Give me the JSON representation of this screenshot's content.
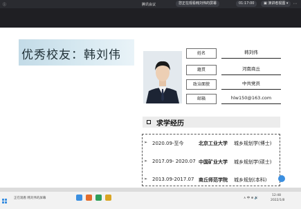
{
  "top_bar": {
    "left_label": "ⓘ",
    "meeting_app": "腾讯会议",
    "share_notice": "您正在观看韩刘伟的屏幕",
    "timer": "01:17:00",
    "view_mode": "▣ 演讲者视图 ▾"
  },
  "slide": {
    "title": "优秀校友：韩刘伟",
    "info": [
      {
        "label": "姓名",
        "value": "韩刘伟"
      },
      {
        "label": "籍贯",
        "value": "河南商丘"
      },
      {
        "label": "政治面貌",
        "value": "中共党员"
      },
      {
        "label": "邮箱",
        "value": "hlw150@163.com"
      }
    ],
    "section_title": "求学经历",
    "education": [
      {
        "arrow": "➢",
        "period": "2020.09-至今",
        "school": "北京工业大学",
        "major": "城乡规划学(博士)"
      },
      {
        "arrow": "➢",
        "period": "2017.09- 2020.07",
        "school": "中国矿业大学",
        "major": "城乡规划学(硕士)"
      },
      {
        "arrow": "➢",
        "period": "2013.09-2017.07",
        "school": "商丘师范学院",
        "major": "城乡规划(本科)"
      }
    ]
  },
  "taskbar": {
    "left_text": "正在观看 韩刘伟的屏幕",
    "tray_text": "∧ 中 ⊕ 🔊",
    "time": "12:48",
    "date": "2022/1/8"
  },
  "colors": {
    "title_gradient_start": "#c3dbe7",
    "accent_blue": "#3b8fe0",
    "dark_bar": "#1f1f23"
  }
}
